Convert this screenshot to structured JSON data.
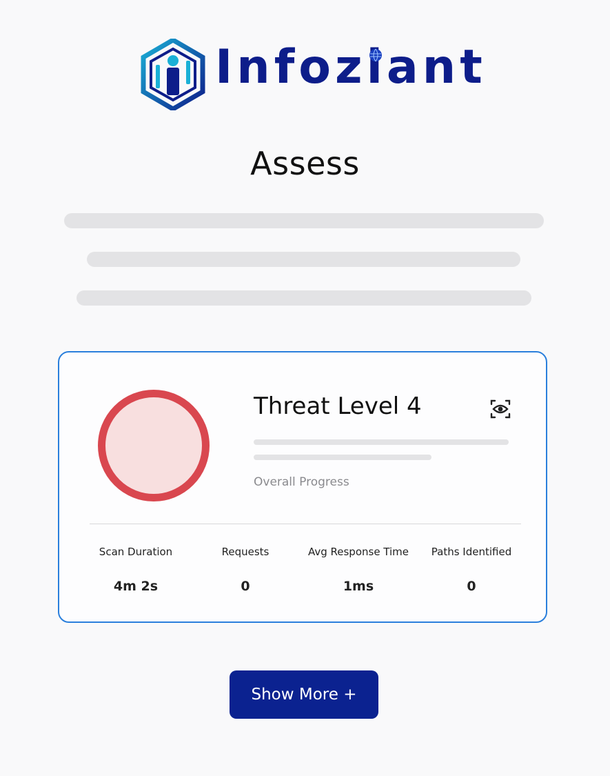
{
  "logo": {
    "wordmark": "Infoziant",
    "brand_color": "#0d1d8a",
    "accent_color": "#1ab0d6"
  },
  "page": {
    "title": "Assess"
  },
  "card": {
    "threat_title": "Threat Level 4",
    "threat_color": "#d9474f",
    "threat_fill": "#f8dfdf",
    "border_color": "#2a7fdc",
    "progress_label": "Overall Progress",
    "action_icon": "eye-scan-icon",
    "stats": [
      {
        "label": "Scan Duration",
        "value": "4m 2s"
      },
      {
        "label": "Requests",
        "value": "0"
      },
      {
        "label": "Avg Response Time",
        "value": "1ms"
      },
      {
        "label": "Paths Identified",
        "value": "0"
      }
    ]
  },
  "button": {
    "label": "Show More +",
    "color": "#0b2290"
  }
}
